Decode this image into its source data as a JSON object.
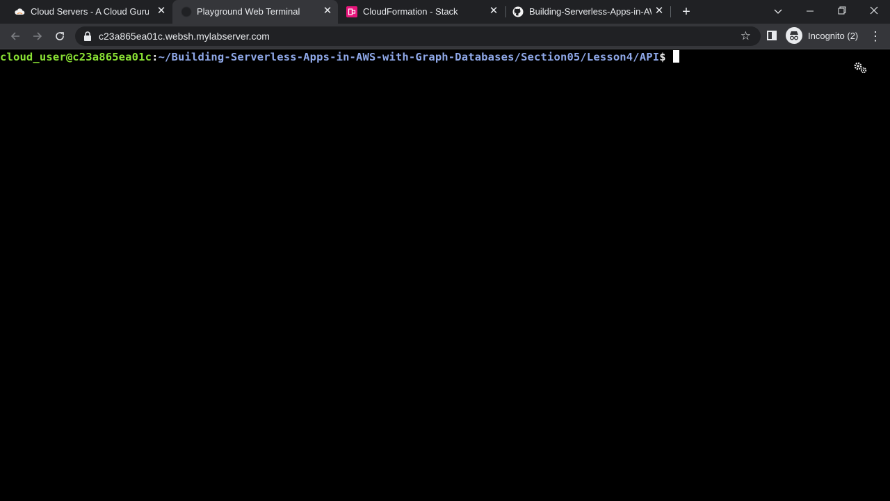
{
  "browser": {
    "tabs": [
      {
        "title": "Cloud Servers - A Cloud Guru",
        "icon": "cloud-icon",
        "active": false
      },
      {
        "title": "Playground Web Terminal",
        "icon": "terminal-icon",
        "active": true
      },
      {
        "title": "CloudFormation - Stack",
        "icon": "cloudformation-icon",
        "active": false
      },
      {
        "title": "Building-Serverless-Apps-in-AWS",
        "icon": "github-icon",
        "active": false
      }
    ],
    "url": "c23a865ea01c.websh.mylabserver.com",
    "profile_label": "Incognito (2)"
  },
  "terminal": {
    "user_host": "cloud_user@c23a865ea01c",
    "colon": ":",
    "path": "~/Building-Serverless-Apps-in-AWS-with-Graph-Databases/Section05/Lesson4/API",
    "dollar": "$"
  },
  "colors": {
    "prompt_user": "#8ae234",
    "prompt_path": "#8fa8e8",
    "terminal_bg": "#000000",
    "cloudformation_accent": "#e7157b"
  }
}
